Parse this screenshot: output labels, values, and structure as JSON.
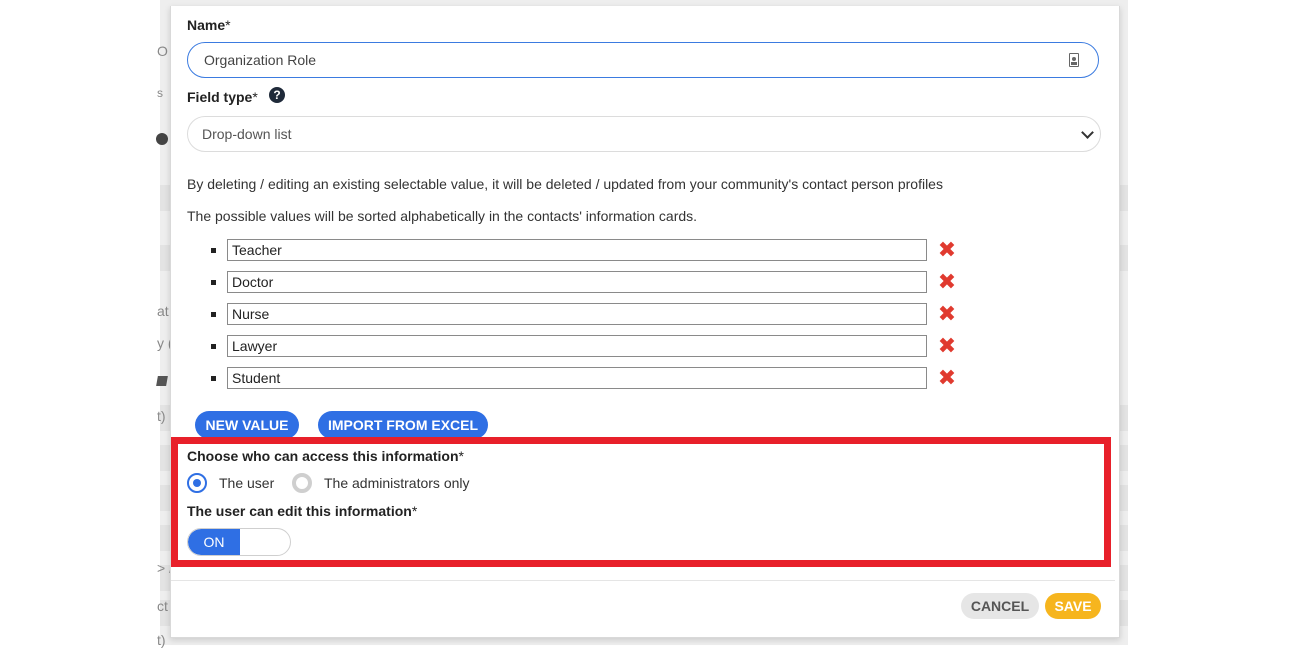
{
  "form": {
    "name_label": "Name",
    "name_required": "*",
    "name_value": "Organization Role",
    "field_type_label": "Field type",
    "field_type_required": "*",
    "field_type_help": "?",
    "field_type_value": "Drop-down list",
    "note_delete": "By deleting / editing an existing selectable value, it will be deleted / updated from your community's contact person profiles",
    "note_sort": "The possible values will be sorted alphabetically in the contacts' information cards.",
    "values": [
      {
        "text": "Teacher"
      },
      {
        "text": "Doctor"
      },
      {
        "text": "Nurse"
      },
      {
        "text": "Lawyer"
      },
      {
        "text": "Student"
      }
    ],
    "delete_glyph": "✖",
    "new_value_label": "NEW VALUE",
    "import_label": "IMPORT FROM EXCEL",
    "access_label": "Choose who can access this information",
    "access_required": "*",
    "access_options": [
      {
        "label": "The user",
        "selected": true
      },
      {
        "label": "The administrators only",
        "selected": false
      }
    ],
    "edit_label": "The user can edit this information",
    "edit_required": "*",
    "toggle_on_label": "ON",
    "cancel_label": "CANCEL",
    "save_label": "SAVE"
  },
  "background": {
    "fragments": [
      "O",
      "s",
      "at",
      "y (",
      "t)",
      "> /",
      "ct",
      "t)"
    ]
  },
  "colors": {
    "accent": "#2f6fe4",
    "delete": "#e03a2f",
    "highlight_border": "#e8202a",
    "save": "#f6b51e"
  }
}
